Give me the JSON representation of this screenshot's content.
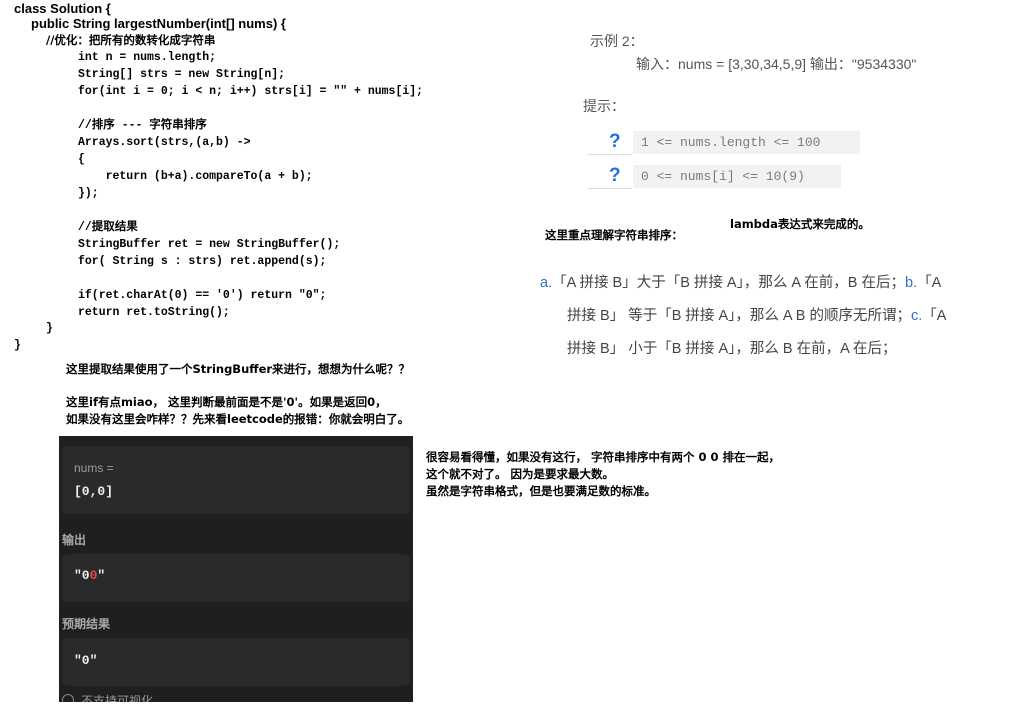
{
  "code": {
    "line1": "class Solution {",
    "line2": "public String largestNumber(int[] nums) {",
    "comment1": "//优化：把所有的数转化成字符串",
    "lines": [
      "int n = nums.length;",
      "String[] strs = new String[n];",
      "for(int i = 0; i < n; i++) strs[i] = \"\" + nums[i];",
      "",
      "//排序 --- 字符串排序",
      "Arrays.sort(strs,(a,b) ->",
      "{",
      "    return (b+a).compareTo(a + b);",
      "});",
      "",
      "//提取结果",
      "StringBuffer ret = new StringBuffer();",
      "for( String s : strs) ret.append(s);",
      "",
      "if(ret.charAt(0) == '0') return \"0\";",
      "return ret.toString();"
    ],
    "close_method": "}",
    "close_class": "}"
  },
  "notes": {
    "stringbuffer": "这里提取结果使用了一个StringBuffer来进行，想想为什么呢？？",
    "if_line1": "这里if有点miao， 这里判断最前面是不是'0'。如果是返回0，",
    "if_line2": "如果没有这里会咋样？？先来看leetcode的报错：你就会明白了。",
    "right_line1": "很容易看得懂，如果没有这行， 字符串排序中有两个 0 0 排在一起，",
    "right_line2": "这个就不对了。 因为是要求最大数。",
    "right_line3": "虽然是字符串格式，但是也要满足数的标准。"
  },
  "example": {
    "title": "示例 2：",
    "io": "输入：nums = [3,30,34,5,9] 输出：\"9534330\"",
    "hint": "提示：",
    "constraint1": "1 <= nums.length <= 100",
    "constraint2": "0 <= nums[i] <= 10(9)",
    "qmark": "?"
  },
  "focus": {
    "label": "这里重点理解字符串排序：",
    "lambda": "lambda表达式来完成的。"
  },
  "explain": {
    "a_mark": "a.",
    "a_text": "「A 拼接 B」大于「B 拼接 A」，那么 A 在前，B 在后；",
    "b_mark": "b.",
    "b_text": "「A",
    "line2_text": "拼接 B」 等于「B 拼接 A」，那么 A B 的顺序无所谓；",
    "c_mark": "c.",
    "c_text": "「A",
    "line3_text": "拼接 B」 小于「B 拼接 A」，那么 B 在前，A 在后；"
  },
  "leetcode": {
    "input_label": "nums =",
    "input_value": "[0,0]",
    "output_label": "输出",
    "output_quote_open": "\"0",
    "output_red": "0",
    "output_quote_close": "\"",
    "expected_label": "预期结果",
    "expected_value": "\"0\"",
    "bottom_text": "不支持可视化"
  },
  "colors": {
    "accent_blue": "#1e6fe0",
    "error_red": "#e24c4c",
    "panel_bg": "#1f1f1f"
  }
}
